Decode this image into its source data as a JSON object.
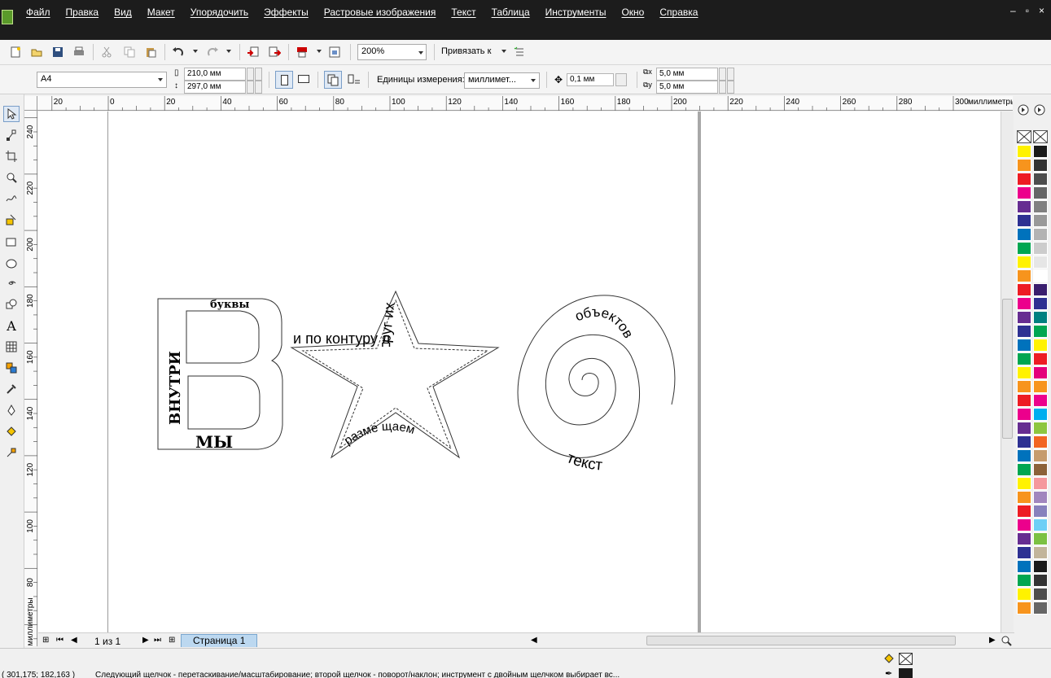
{
  "menu": {
    "items": [
      "Файл",
      "Правка",
      "Вид",
      "Макет",
      "Упорядочить",
      "Эффекты",
      "Растровые изображения",
      "Текст",
      "Таблица",
      "Инструменты",
      "Окно",
      "Справка"
    ],
    "window_controls": [
      "–",
      "▫",
      "×"
    ]
  },
  "toolbar": {
    "zoom": "200%",
    "snap_label": "Привязать к"
  },
  "property_bar": {
    "paper_size": "A4",
    "width": "210,0 мм",
    "height": "297,0 мм",
    "units_label": "Единицы измерения:",
    "units_value": "миллимет...",
    "nudge": "0,1 мм",
    "dup_x": "5,0 мм",
    "dup_y": "5,0 мм"
  },
  "ruler": {
    "h_labels": [
      "20",
      "0",
      "20",
      "40",
      "60",
      "80",
      "100",
      "120",
      "140",
      "160",
      "180",
      "200",
      "220",
      "240",
      "260",
      "280",
      "300"
    ],
    "h_unit": "миллиметры",
    "v_labels": [
      "240",
      "220",
      "200",
      "180",
      "160",
      "140",
      "120",
      "100",
      "80"
    ],
    "v_unit": "миллиметры"
  },
  "drawing": {
    "letter_texts": {
      "top": "буквы",
      "side": "ВНУТРИ",
      "bottom": "МЫ"
    },
    "star_texts": {
      "outer_path": "и по контуру друг их",
      "inner_path": "разме щаем"
    },
    "spiral_texts": {
      "upper": "объектов",
      "lower": "текст"
    }
  },
  "pages": {
    "count": "1 из 1",
    "tab": "Страница 1"
  },
  "status": {
    "coords": "( 301,175; 182,163 )",
    "message": "Следующий щелчок - перетаскивание/масштабирование; второй щелчок - поворот/наклон; инструмент с двойным щелчком выбирает вс..."
  },
  "colors": {
    "palette": [
      "#1a1a1a",
      "#333333",
      "#4d4d4d",
      "#666666",
      "#808080",
      "#999999",
      "#b3b3b3",
      "#cccccc",
      "#e6e6e6",
      "#ffffff",
      "#3a1e6e",
      "#2e3192",
      "#008080",
      "#00a651",
      "#fff200",
      "#ed1c24",
      "#e4007c",
      "#f7941d",
      "#ec008c",
      "#00aeef",
      "#8dc63f",
      "#f26522",
      "#c69c6d",
      "#8c6239",
      "#f5989d",
      "#a186be",
      "#8781bd",
      "#6dcff6",
      "#7bc143",
      "#c2b59b"
    ],
    "accent_left": [
      "#fff200",
      "#f7941d",
      "#ed1c24",
      "#ec008c",
      "#662d91",
      "#2e3192",
      "#0072bc",
      "#00a651"
    ]
  }
}
